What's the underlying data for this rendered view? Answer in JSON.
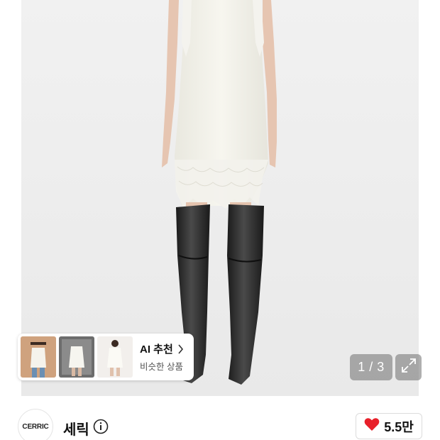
{
  "product_image": {
    "alt": "",
    "counter": "1 / 3"
  },
  "ai_recommend": {
    "title": "AI 추천",
    "subtitle": "비슷한 상품",
    "thumbnails": [
      "thumb-1",
      "thumb-2",
      "thumb-3"
    ]
  },
  "brand": {
    "logo_text": "CERRIC",
    "name": "세릭"
  },
  "like": {
    "count": "5.5만",
    "color": "#e8202a"
  },
  "icons": {
    "expand": "expand-icon",
    "info": "info-icon",
    "heart": "heart-icon",
    "chevron": "chevron-right-icon"
  }
}
